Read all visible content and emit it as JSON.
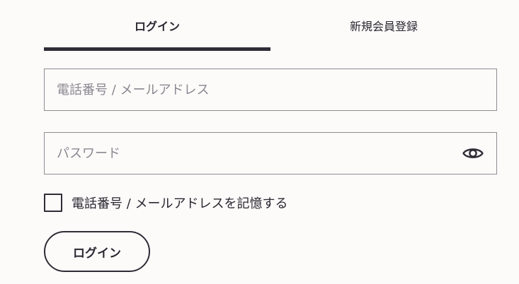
{
  "tabs": {
    "login_label": "ログイン",
    "register_label": "新規会員登録"
  },
  "form": {
    "login_id": {
      "placeholder": "電話番号 / メールアドレス",
      "value": ""
    },
    "password": {
      "placeholder": "パスワード",
      "value": "",
      "toggle_icon": "eye-icon"
    },
    "remember": {
      "label": "電話番号 / メールアドレスを記憶する",
      "checked": false
    },
    "submit_label": "ログイン"
  },
  "colors": {
    "background": "#fdfbfa",
    "accent": "#2f2c36",
    "border": "#8f8c92",
    "placeholder": "#8a8790"
  }
}
